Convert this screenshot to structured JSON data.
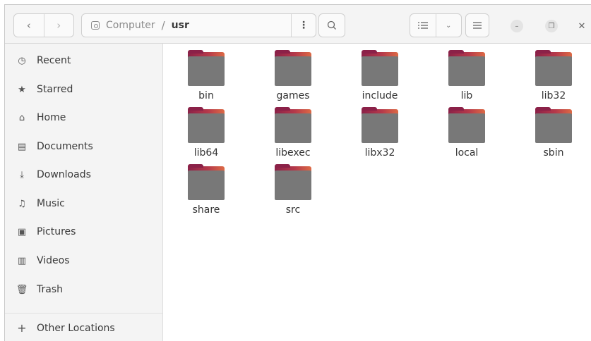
{
  "header": {
    "back_icon": "‹",
    "forward_icon": "›",
    "path": {
      "root": "Computer",
      "separator": "/",
      "current": "usr",
      "menu_icon": "⋮"
    },
    "search_icon": "search-icon",
    "view": {
      "list_icon": "list-icon",
      "dropdown_icon": "⌄"
    },
    "menu_icon": "hamburger-icon",
    "window": {
      "minimize": "–",
      "maximize": "❐",
      "close": "✕"
    }
  },
  "sidebar": {
    "items": [
      {
        "label": "Recent",
        "icon": "◷"
      },
      {
        "label": "Starred",
        "icon": "★"
      },
      {
        "label": "Home",
        "icon": "⌂"
      },
      {
        "label": "Documents",
        "icon": "▤"
      },
      {
        "label": "Downloads",
        "icon": "⤓"
      },
      {
        "label": "Music",
        "icon": "♫"
      },
      {
        "label": "Pictures",
        "icon": "▣"
      },
      {
        "label": "Videos",
        "icon": "▥"
      },
      {
        "label": "Trash",
        "icon": "🗑"
      }
    ],
    "other_locations": {
      "label": "Other Locations",
      "icon": "+"
    }
  },
  "folders": [
    "bin",
    "games",
    "include",
    "lib",
    "lib32",
    "lib64",
    "libexec",
    "libx32",
    "local",
    "sbin",
    "share",
    "src"
  ],
  "colors": {
    "folder_body": "#787878",
    "folder_tab_start": "#8b2148",
    "folder_tab_end": "#dd6a45",
    "sidebar_bg": "#f4f4f4"
  }
}
